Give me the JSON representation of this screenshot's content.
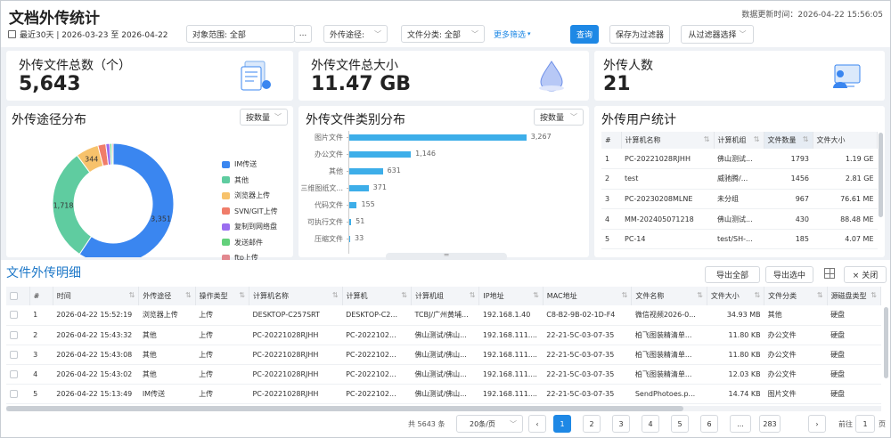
{
  "header": {
    "title": "文档外传统计",
    "updated_label": "数据更新时间：",
    "updated_value": "2026-04-22 15:56:05"
  },
  "filters": {
    "date_range": "最近30天 | 2026-03-23 至 2026-04-22",
    "scope": "对象范围: 全部",
    "scope_more": "...",
    "channel": "外传途径:",
    "category": "文件分类: 全部",
    "more": "更多筛选",
    "query": "查询",
    "save_filter": "保存为过滤器",
    "from_filter": "从过滤器选择"
  },
  "kpis": [
    {
      "label": "外传文件总数（个）",
      "value": "5,643",
      "icon": "document-stack-icon"
    },
    {
      "label": "外传文件总大小",
      "value": "11.47 GB",
      "icon": "water-drop-icon"
    },
    {
      "label": "外传人数",
      "value": "21",
      "icon": "user-monitor-icon"
    }
  ],
  "channel_chart": {
    "title": "外传途径分布",
    "sort": "按数量",
    "type": "pie",
    "slices": [
      {
        "name": "IM传送",
        "value": 3351,
        "color": "#3a86f0"
      },
      {
        "name": "其他",
        "value": 1718,
        "color": "#5fcca0"
      },
      {
        "name": "浏览器上传",
        "value": 344,
        "color": "#f7c26b"
      },
      {
        "name": "SVN/GIT上传",
        "value": 120,
        "color": "#f07d6a"
      },
      {
        "name": "复制到网络盘",
        "value": 60,
        "color": "#9b6ef0"
      },
      {
        "name": "发送邮件",
        "value": 30,
        "color": "#63d07b"
      },
      {
        "name": "ftp上传",
        "value": 20,
        "color": "#e2888f"
      }
    ],
    "labels": [
      "3,351",
      "1,718",
      "344"
    ]
  },
  "category_chart": {
    "title": "外传文件类别分布",
    "sort": "按数量",
    "type": "bar",
    "categories": [
      "图片文件",
      "办公文件",
      "其他",
      "三维图纸文...",
      "代码文件",
      "可执行文件",
      "压缩文件"
    ],
    "values": [
      3267,
      1146,
      631,
      371,
      155,
      51,
      33
    ],
    "xlim": [
      0,
      3500
    ]
  },
  "user_stats": {
    "title": "外传用户统计",
    "columns": [
      "#",
      "计算机名称",
      "计算机组",
      "文件数量",
      "文件大小"
    ],
    "rows": [
      [
        "1",
        "PC-20221028RJHH",
        "佛山测试...",
        "1793",
        "1.19 GE"
      ],
      [
        "2",
        "test",
        "威驰腾/...",
        "1456",
        "2.81 GE"
      ],
      [
        "3",
        "PC-20230208MLNE",
        "未分组",
        "967",
        "76.61 ME"
      ],
      [
        "4",
        "MM-202405071218",
        "佛山测试...",
        "430",
        "88.48 ME"
      ],
      [
        "5",
        "PC-14",
        "test/SH-...",
        "185",
        "4.07 ME"
      ]
    ]
  },
  "detail": {
    "title": "文件外传明细",
    "export_all": "导出全部",
    "export_sel": "导出选中",
    "close": "× 关闭",
    "columns": [
      "#",
      "时间",
      "外传途径",
      "操作类型",
      "计算机名称",
      "计算机",
      "计算机组",
      "IP地址",
      "MAC地址",
      "文件名称",
      "文件大小",
      "文件分类",
      "源磁盘类型"
    ],
    "rows": [
      [
        "1",
        "2026-04-22 15:52:19",
        "浏览器上传",
        "上传",
        "DESKTOP-C257SRT",
        "DESKTOP-C2...",
        "TCBJ/广州黄埔...",
        "192.168.1.40",
        "C8-B2-9B-02-1D-F4",
        "微信视频2026-0...",
        "34.93 MB",
        "其他",
        "硬盘"
      ],
      [
        "2",
        "2026-04-22 15:43:32",
        "其他",
        "上传",
        "PC-20221028RJHH",
        "PC-2022102...",
        "佛山测试/佛山...",
        "192.168.111....",
        "22-21-5C-03-07-35",
        "柏飞图装精清单...",
        "11.80 KB",
        "办公文件",
        "硬盘"
      ],
      [
        "3",
        "2026-04-22 15:43:08",
        "其他",
        "上传",
        "PC-20221028RJHH",
        "PC-2022102...",
        "佛山测试/佛山...",
        "192.168.111....",
        "22-21-5C-03-07-35",
        "柏飞图装精清单...",
        "11.80 KB",
        "办公文件",
        "硬盘"
      ],
      [
        "4",
        "2026-04-22 15:43:02",
        "其他",
        "上传",
        "PC-20221028RJHH",
        "PC-2022102...",
        "佛山测试/佛山...",
        "192.168.111....",
        "22-21-5C-03-07-35",
        "柏飞图装精清单...",
        "12.03 KB",
        "办公文件",
        "硬盘"
      ],
      [
        "5",
        "2026-04-22 15:13:49",
        "IM传送",
        "上传",
        "PC-20221028RJHH",
        "PC-2022102...",
        "佛山测试/佛山...",
        "192.168.111....",
        "22-21-5C-03-07-35",
        "SendPhotoes.p...",
        "14.74 KB",
        "图片文件",
        "硬盘"
      ]
    ]
  },
  "pagination": {
    "total": "共 5643 条",
    "page_size": "20条/页",
    "pages": [
      "1",
      "2",
      "3",
      "4",
      "5",
      "6",
      "...",
      "283"
    ],
    "goto_label": "前往",
    "goto_value": "1",
    "goto_unit": "页"
  }
}
